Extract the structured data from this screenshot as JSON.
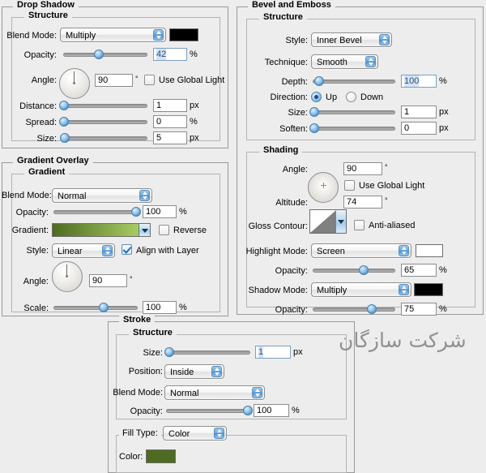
{
  "dropShadow": {
    "title": "Drop Shadow",
    "structure": "Structure",
    "blend_mode_label": "Blend Mode:",
    "blend_mode_value": "Multiply",
    "blend_color": "#000000",
    "opacity_label": "Opacity:",
    "opacity_value": "42",
    "opacity_unit": "%",
    "angle_label": "Angle:",
    "angle_value": "90",
    "angle_unit": "°",
    "use_global_light": "Use Global Light",
    "use_global_light_checked": false,
    "distance_label": "Distance:",
    "distance_value": "1",
    "distance_unit": "px",
    "spread_label": "Spread:",
    "spread_value": "0",
    "spread_unit": "%",
    "size_label": "Size:",
    "size_value": "5",
    "size_unit": "px"
  },
  "gradientOverlay": {
    "title": "Gradient Overlay",
    "group": "Gradient",
    "blend_mode_label": "Blend Mode:",
    "blend_mode_value": "Normal",
    "opacity_label": "Opacity:",
    "opacity_value": "100",
    "opacity_unit": "%",
    "gradient_label": "Gradient:",
    "gradient_from": "#4e6b22",
    "gradient_to": "#a8cc63",
    "reverse_label": "Reverse",
    "reverse_checked": false,
    "style_label": "Style:",
    "style_value": "Linear",
    "align_label": "Align with Layer",
    "align_checked": true,
    "angle_label": "Angle:",
    "angle_value": "90",
    "angle_unit": "°",
    "scale_label": "Scale:",
    "scale_value": "100",
    "scale_unit": "%"
  },
  "bevel": {
    "title": "Bevel and Emboss",
    "structure": "Structure",
    "style_label": "Style:",
    "style_value": "Inner Bevel",
    "technique_label": "Technique:",
    "technique_value": "Smooth",
    "depth_label": "Depth:",
    "depth_value": "100",
    "depth_unit": "%",
    "direction_label": "Direction:",
    "direction_up": "Up",
    "direction_down": "Down",
    "direction_selected": "Up",
    "size_label": "Size:",
    "size_value": "1",
    "size_unit": "px",
    "soften_label": "Soften:",
    "soften_value": "0",
    "soften_unit": "px"
  },
  "shading": {
    "group": "Shading",
    "angle_label": "Angle:",
    "angle_value": "90",
    "angle_unit": "°",
    "use_global_light": "Use Global Light",
    "use_global_light_checked": false,
    "altitude_label": "Altitude:",
    "altitude_value": "74",
    "altitude_unit": "°",
    "gloss_contour_label": "Gloss Contour:",
    "anti_aliased_label": "Anti-aliased",
    "anti_aliased_checked": false,
    "highlight_mode_label": "Highlight Mode:",
    "highlight_mode_value": "Screen",
    "highlight_color": "#ffffff",
    "highlight_opacity_label": "Opacity:",
    "highlight_opacity_value": "65",
    "highlight_opacity_unit": "%",
    "shadow_mode_label": "Shadow Mode:",
    "shadow_mode_value": "Multiply",
    "shadow_color": "#000000",
    "shadow_opacity_label": "Opacity:",
    "shadow_opacity_value": "75",
    "shadow_opacity_unit": "%"
  },
  "stroke": {
    "title": "Stroke",
    "structure": "Structure",
    "size_label": "Size:",
    "size_value": "1",
    "size_unit": "px",
    "position_label": "Position:",
    "position_value": "Inside",
    "blend_mode_label": "Blend Mode:",
    "blend_mode_value": "Normal",
    "opacity_label": "Opacity:",
    "opacity_value": "100",
    "opacity_unit": "%",
    "fill_type_label": "Fill Type:",
    "fill_type_value": "Color",
    "color_label": "Color:",
    "color_value": "#4e6b22"
  },
  "watermark": {
    "text": "شرکت سازگان"
  }
}
